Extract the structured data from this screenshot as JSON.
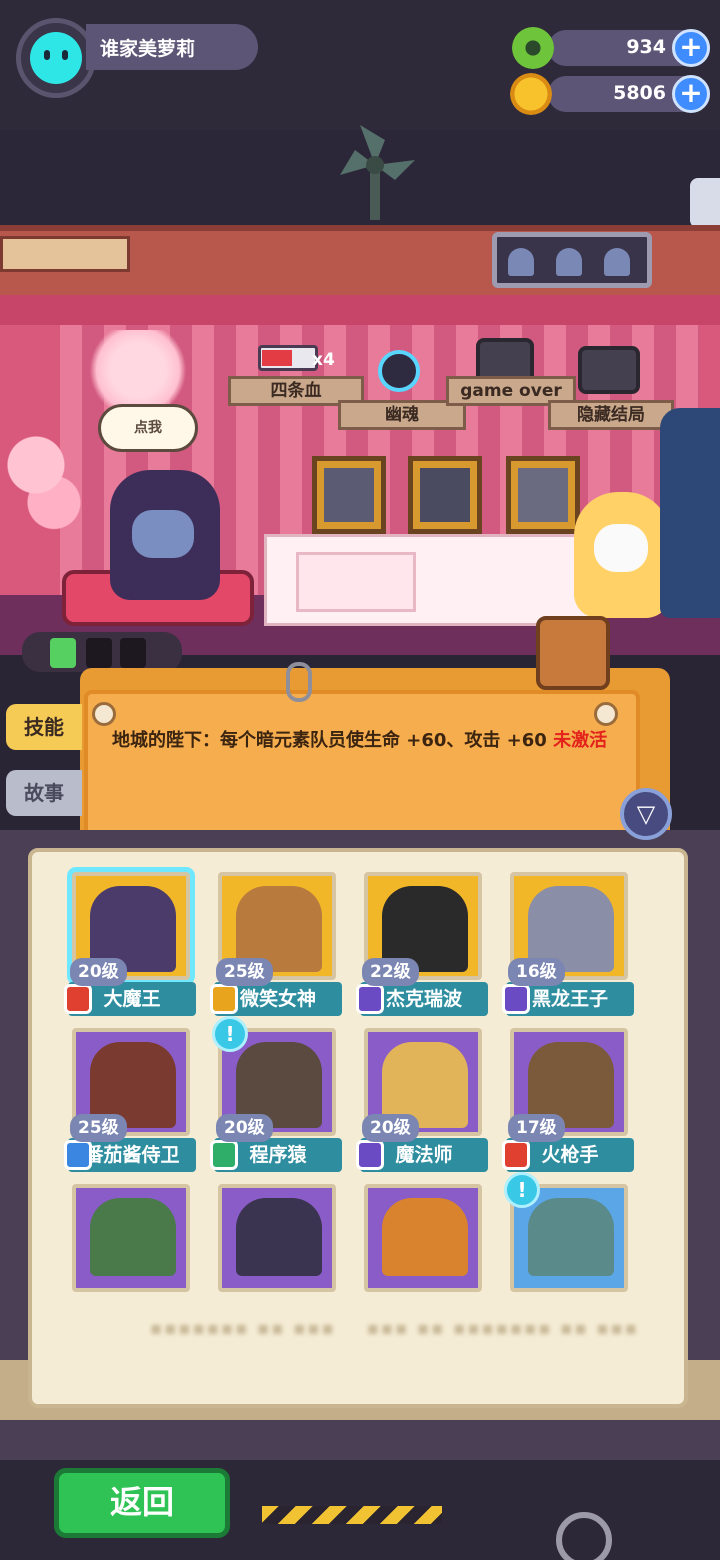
{
  "player": {
    "name": "谁家美萝莉",
    "avatar_icon": "cyan-cat-icon"
  },
  "currency": {
    "gems": {
      "value": "934",
      "icon": "green-donut-icon"
    },
    "coins": {
      "value": "5806",
      "icon": "gold-planet-icon"
    },
    "add_icon": "plus-icon"
  },
  "achievements": [
    {
      "label": "四条血",
      "icon": "hp-bar-icon",
      "badge": "x4"
    },
    {
      "label": "幽魂",
      "icon": "skull-ghost-icon"
    },
    {
      "label": "game over",
      "icon": "tv-grave-icon"
    },
    {
      "label": "隐藏结局",
      "icon": "tv-image-icon"
    }
  ],
  "speech_bubble": "点我",
  "skill_panel": {
    "description": "地城的陛下：每个暗元素队员使生命 +60、攻击 +60",
    "status": "未激活"
  },
  "side_tabs": {
    "skill": "技能",
    "story": "故事"
  },
  "filter_icon": "filter-icon",
  "heroes": [
    {
      "level": "20级",
      "name": "大魔王",
      "badge_color": "#e0402f",
      "art": "#4a3b6a",
      "frame": "#f2b729",
      "selected": true
    },
    {
      "level": "25级",
      "name": "微笑女神",
      "badge_color": "#e8a41d",
      "art": "#b97a3d",
      "frame": "#f2b729"
    },
    {
      "level": "22级",
      "name": "杰克瑞波",
      "badge_color": "#6a4bc4",
      "art": "#2a2a2a",
      "frame": "#f2b729"
    },
    {
      "level": "16级",
      "name": "黑龙王子",
      "badge_color": "#6a4bc4",
      "art": "#8a8ea6",
      "frame": "#f2b729"
    },
    {
      "level": "25级",
      "name": "番茄酱侍卫",
      "badge_color": "#3a86e0",
      "art": "#7a3a30",
      "frame": "#8a5cc8"
    },
    {
      "level": "20级",
      "name": "程序猿",
      "badge_color": "#2fae6a",
      "art": "#5a4a40",
      "frame": "#8a5cc8",
      "alert": true
    },
    {
      "level": "20级",
      "name": "魔法师",
      "badge_color": "#6a4bc4",
      "art": "#e2b45a",
      "frame": "#8a5cc8"
    },
    {
      "level": "17级",
      "name": "火枪手",
      "badge_color": "#e0402f",
      "art": "#7b5a3c",
      "frame": "#8a5cc8"
    },
    {
      "art": "#4a7a4a",
      "frame": "#8a5cc8"
    },
    {
      "art": "#3a3450",
      "frame": "#8a5cc8"
    },
    {
      "art": "#d9832e",
      "frame": "#8a5cc8"
    },
    {
      "art": "#5a8a8a",
      "frame": "#5aa6e6",
      "alert": true
    }
  ],
  "alert_icon": "exclamation-icon",
  "back_button": "返回"
}
